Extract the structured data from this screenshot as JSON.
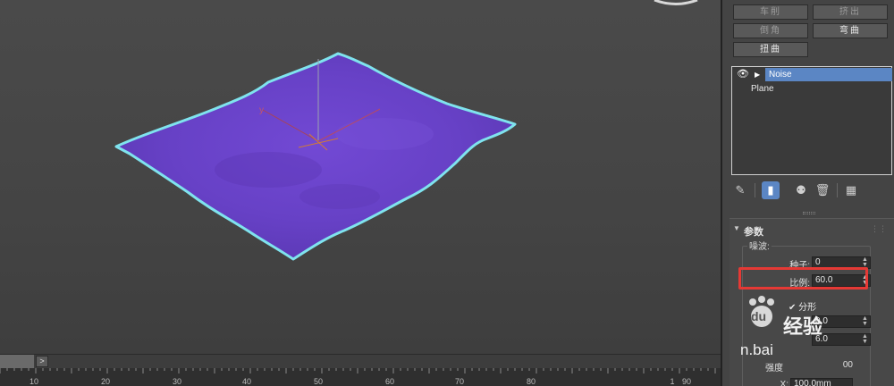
{
  "modifier_buttons": {
    "extrude": "车削",
    "bevel": "挤出",
    "chamfer": "倒角",
    "bend": "弯曲",
    "twist": "扭曲"
  },
  "stack": {
    "selected": "Noise",
    "base": "Plane"
  },
  "tool_icons": [
    "pin-icon",
    "show-end-result-icon",
    "make-unique-icon",
    "remove-modifier-icon",
    "configure-sets-icon"
  ],
  "rollout": {
    "title": "参数",
    "group_label": "噪波:",
    "seed_label": "种子:",
    "seed_value": "0",
    "scale_label": "比例:",
    "scale_value": "60.0",
    "fractal_label": "分形",
    "fractal_checked": true,
    "roughness_value": "0.0",
    "iterations_value": "6.0",
    "x_label": "X:",
    "x_value": "100.0mm",
    "strength_label": "强度",
    "partial_value": "00"
  },
  "timeline": {
    "next_label": ">",
    "ruler_labels": [
      "10",
      "20",
      "30",
      "40",
      "50",
      "60",
      "70",
      "80",
      "1",
      "90"
    ]
  },
  "watermark": {
    "brand": "经验",
    "logo": "du",
    "url_fragment": "n.bai"
  },
  "colors": {
    "mesh_fill": "#6a43c9",
    "mesh_edge": "#7fe3ee",
    "selection": "#5b86c4",
    "highlight_box": "#e53935"
  }
}
